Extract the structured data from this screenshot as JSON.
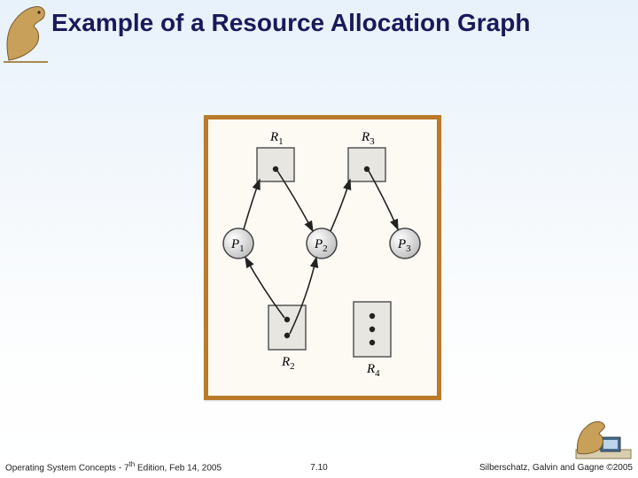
{
  "title": "Example of a Resource Allocation Graph",
  "footer": {
    "left_prefix": "Operating System Concepts - 7",
    "left_sup": "th",
    "left_suffix": " Edition, Feb 14, 2005",
    "center": "7.10",
    "right": "Silberschatz, Galvin and Gagne ©2005"
  },
  "graph": {
    "resources": {
      "R1": {
        "label_prefix": "R",
        "label_sub": "1",
        "instances": 1
      },
      "R2": {
        "label_prefix": "R",
        "label_sub": "2",
        "instances": 2
      },
      "R3": {
        "label_prefix": "R",
        "label_sub": "3",
        "instances": 1
      },
      "R4": {
        "label_prefix": "R",
        "label_sub": "4",
        "instances": 3
      }
    },
    "processes": {
      "P1": {
        "label_prefix": "P",
        "label_sub": "1"
      },
      "P2": {
        "label_prefix": "P",
        "label_sub": "2"
      },
      "P3": {
        "label_prefix": "P",
        "label_sub": "3"
      }
    },
    "edges": [
      {
        "from": "R1",
        "to": "P2",
        "kind": "assignment"
      },
      {
        "from": "R2",
        "to": "P1",
        "kind": "assignment"
      },
      {
        "from": "R2",
        "to": "P2",
        "kind": "assignment"
      },
      {
        "from": "R3",
        "to": "P3",
        "kind": "assignment"
      },
      {
        "from": "P1",
        "to": "R1",
        "kind": "request"
      },
      {
        "from": "P2",
        "to": "R3",
        "kind": "request"
      }
    ]
  }
}
